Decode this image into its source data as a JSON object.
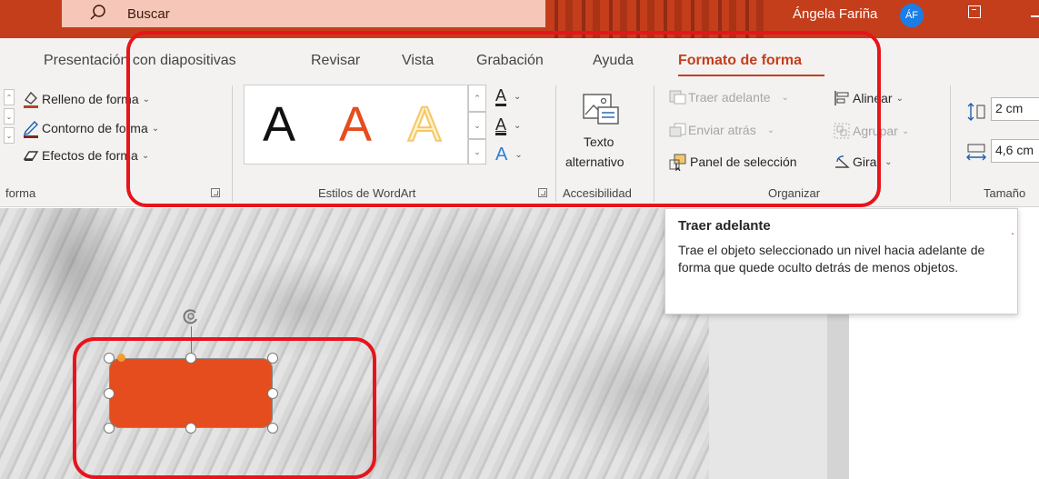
{
  "titlebar": {
    "search_label": "Buscar",
    "user_name": "Ángela Fariña",
    "user_initials": "ÁF"
  },
  "tabs": [
    {
      "label": "Presentación con diapositivas"
    },
    {
      "label": "Revisar"
    },
    {
      "label": "Vista"
    },
    {
      "label": "Grabación"
    },
    {
      "label": "Ayuda"
    },
    {
      "label": "Formato de forma",
      "active": true
    }
  ],
  "ribbon": {
    "shape_styles": {
      "fill": "Relleno de forma",
      "outline": "Contorno de forma",
      "effects": "Efectos de forma",
      "group_label": "forma"
    },
    "wordart": {
      "letter": "A",
      "group_label": "Estilos de WordArt"
    },
    "accessibility": {
      "alt_text_line1": "Texto",
      "alt_text_line2": "alternativo",
      "group_label": "Accesibilidad"
    },
    "arrange": {
      "bring_forward": "Traer adelante",
      "send_backward": "Enviar atrás",
      "selection_pane": "Panel de selección",
      "align": "Alinear",
      "group": "Agrupar",
      "rotate": "Girar",
      "group_label": "Organizar"
    },
    "size": {
      "height": "2 cm",
      "width": "4,6 cm",
      "group_label": "Tamaño"
    }
  },
  "tooltip": {
    "title": "Traer adelante",
    "body": "Trae el objeto seleccionado un nivel hacia adelante de forma que quede oculto detrás de menos objetos."
  },
  "colors": {
    "accent": "#c43e1c",
    "highlight_box": "#e8141b",
    "shape_fill": "#e54d1f"
  }
}
